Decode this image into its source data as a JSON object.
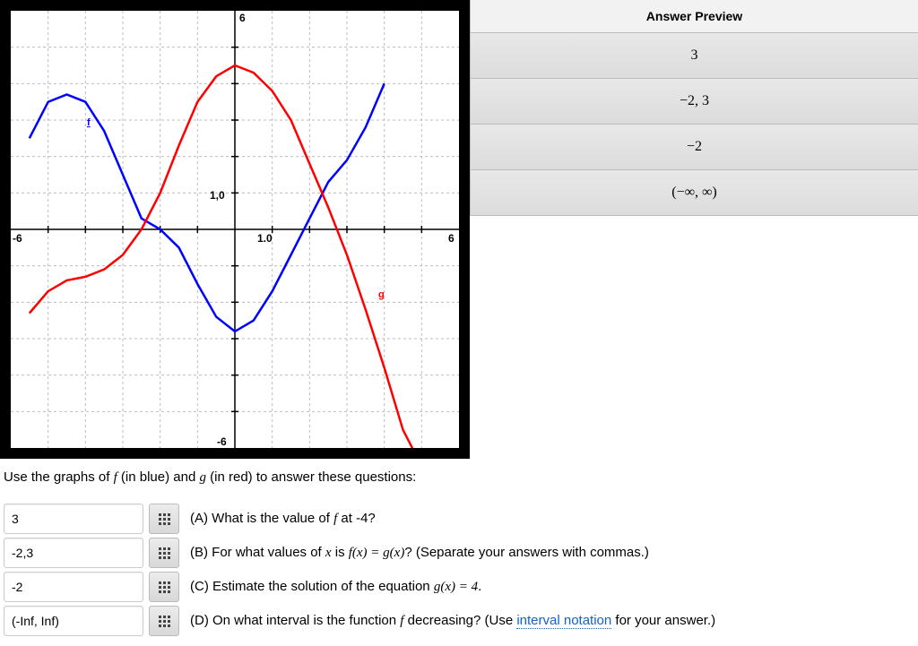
{
  "chart_data": {
    "type": "line",
    "xlim": [
      -6,
      6
    ],
    "ylim": [
      -6,
      6
    ],
    "xlabel": "",
    "ylabel": "",
    "title": "",
    "x_ticks": [
      -6,
      6
    ],
    "y_ticks": [
      -6,
      6
    ],
    "scale_labels": [
      "1,0",
      "1.0"
    ],
    "series": [
      {
        "name": "f",
        "color": "#0000ff",
        "x": [
          -5.5,
          -5,
          -4.5,
          -4,
          -3.5,
          -3,
          -2.5,
          -2,
          -1.5,
          -1,
          -0.5,
          0,
          0.5,
          1,
          1.5,
          2,
          2.5,
          3,
          3.5,
          4
        ],
        "y": [
          2.5,
          3.5,
          3.7,
          3.5,
          2.7,
          1.5,
          0.3,
          0,
          -0.5,
          -1.5,
          -2.4,
          -2.8,
          -2.5,
          -1.7,
          -0.7,
          0.3,
          1.3,
          1.9,
          2.8,
          4.0
        ]
      },
      {
        "name": "g",
        "color": "#ff0000",
        "x": [
          -5.5,
          -5,
          -4.5,
          -4,
          -3.5,
          -3,
          -2.5,
          -2,
          -1.5,
          -1,
          -0.5,
          0,
          0.5,
          1,
          1.5,
          2,
          2.5,
          3,
          3.5,
          4,
          4.5,
          5
        ],
        "y": [
          -2.3,
          -1.7,
          -1.4,
          -1.3,
          -1.1,
          -0.7,
          0.0,
          1.0,
          2.3,
          3.5,
          4.2,
          4.5,
          4.3,
          3.8,
          3.0,
          1.8,
          0.6,
          -0.7,
          -2.2,
          -3.8,
          -5.5,
          -6.5
        ]
      }
    ]
  },
  "preview": {
    "header": "Answer Preview",
    "rows": [
      "3",
      "−2, 3",
      "−2",
      "(−∞, ∞)"
    ]
  },
  "instruction": {
    "pre": "Use the graphs of ",
    "f": "f",
    "mid1": " (in blue) and ",
    "g": "g",
    "post": " (in red) to answer these questions:"
  },
  "questions": {
    "a": {
      "value": "3",
      "label_pre": "(A) What is the value of ",
      "f": "f",
      "label_post": " at -4?"
    },
    "b": {
      "value": "-2,3",
      "label_pre": "(B) For what values of ",
      "x": "x",
      "mid": " is ",
      "eq": "f(x) = g(x)",
      "post": "? (Separate your answers with commas.)"
    },
    "c": {
      "value": "-2",
      "label_pre": "(C) Estimate the solution of the equation ",
      "eq": "g(x) = 4",
      "post": "."
    },
    "d": {
      "value": "(-Inf, Inf)",
      "label_pre": "(D) On what interval is the function ",
      "f": "f",
      "mid": " decreasing? (Use ",
      "link": "interval notation",
      "post": " for your answer.)"
    }
  },
  "axis": {
    "neg6": "-6",
    "pos6": "6",
    "top6": "6",
    "bot6": "-6",
    "one_x": "1.0",
    "one_y": "1,0",
    "f_label": "f",
    "g_label": "g"
  }
}
